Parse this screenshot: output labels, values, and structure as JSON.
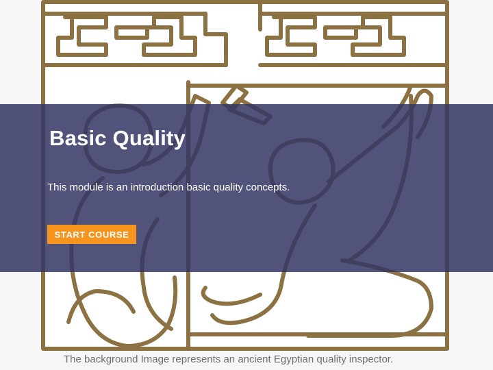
{
  "hero": {
    "title": "Basic Quality",
    "description": "This module is an introduction basic quality concepts.",
    "start_button_label": "START COURSE"
  },
  "caption": "The background Image represents an ancient Egyptian quality inspector.",
  "colors": {
    "overlay": "#343764",
    "button": "#f7941d",
    "art_stroke": "#8c7142",
    "background": "#f6f6f6"
  },
  "background_image": {
    "icon": "egyptian-inspector-artwork"
  }
}
